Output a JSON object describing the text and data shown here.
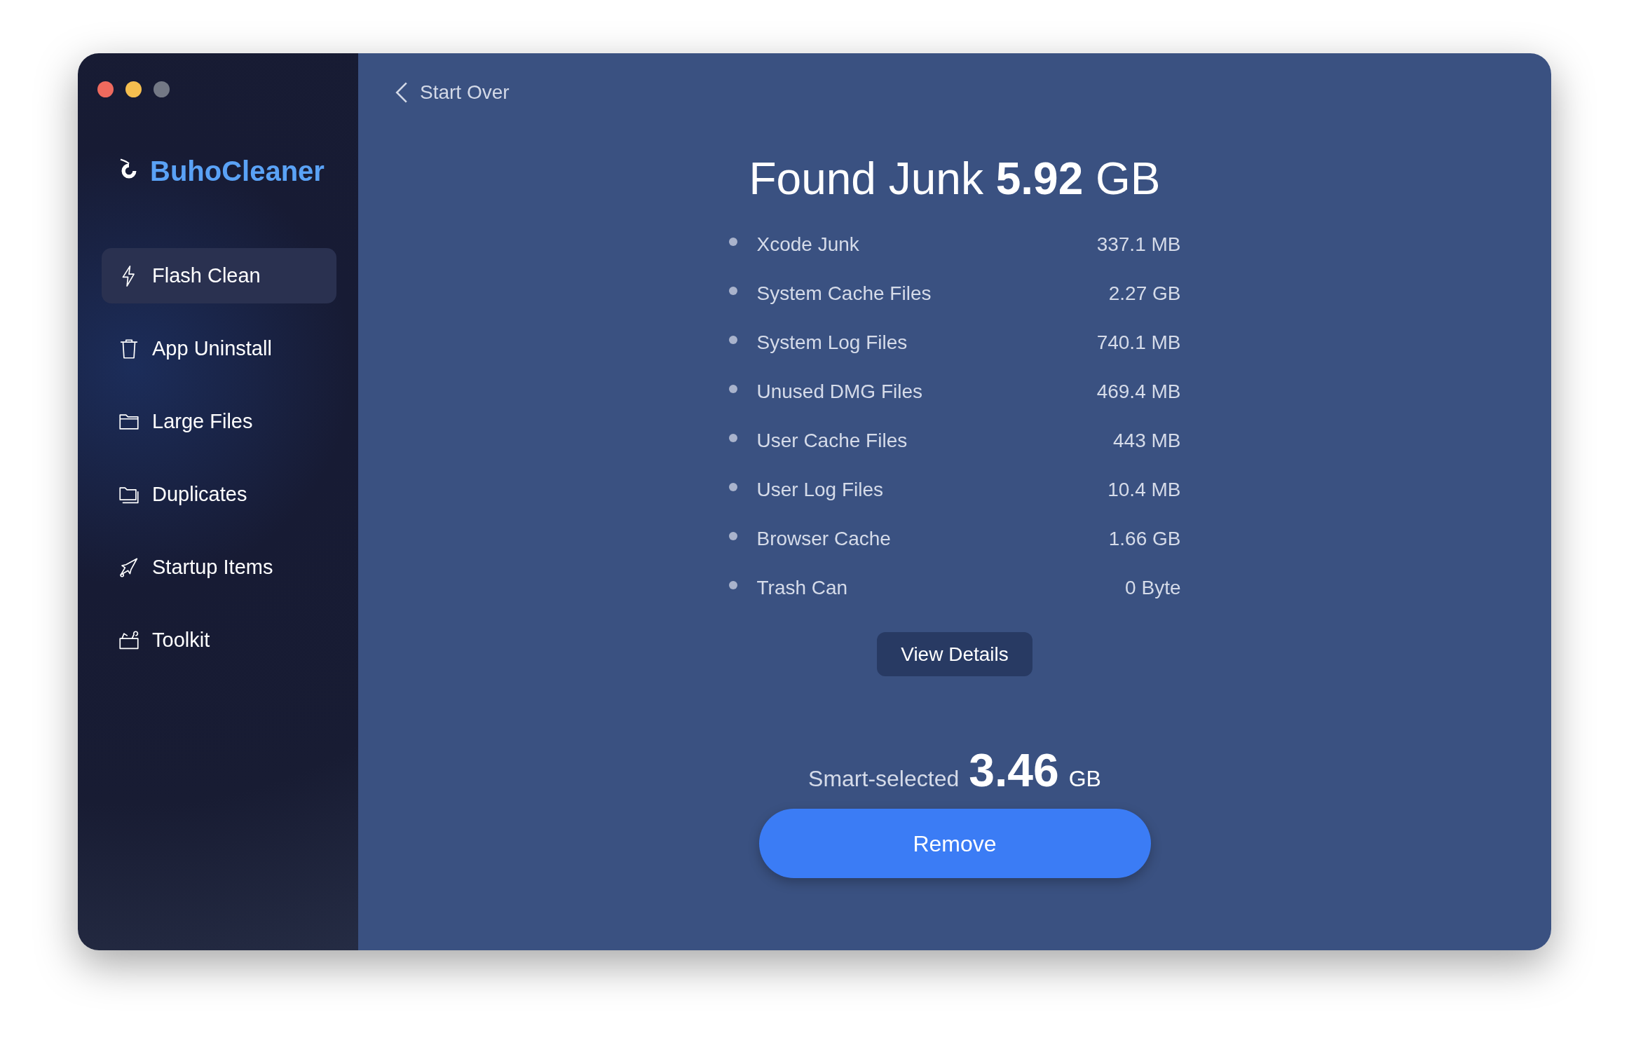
{
  "window": {
    "controls": [
      {
        "kind": "close"
      },
      {
        "kind": "minimize"
      },
      {
        "kind": "zoom"
      }
    ]
  },
  "sidebar": {
    "logo": "BuhoCleaner",
    "items": [
      {
        "label": "Flash Clean",
        "selected": true
      },
      {
        "label": "App Uninstall",
        "selected": false
      },
      {
        "label": "Large Files",
        "selected": false
      },
      {
        "label": "Duplicates",
        "selected": false
      },
      {
        "label": "Startup Items",
        "selected": false
      },
      {
        "label": "Toolkit",
        "selected": false
      }
    ]
  },
  "header": {
    "back": "Start Over"
  },
  "summary": {
    "title": "Found Junk **5.92** GB",
    "items": [
      {
        "name": "Xcode Junk",
        "size": "337.1 MB"
      },
      {
        "name": "System Cache Files",
        "size": "2.27 GB"
      },
      {
        "name": "System Log Files",
        "size": "740.1 MB"
      },
      {
        "name": "Unused DMG Files",
        "size": "469.4 MB"
      },
      {
        "name": "User Cache Files",
        "size": "443 MB"
      },
      {
        "name": "User Log Files",
        "size": "10.4 MB"
      },
      {
        "name": "Browser Cache",
        "size": "1.66 GB"
      },
      {
        "name": "Trash Can",
        "size": "0 Byte"
      }
    ],
    "details_button": "View Details",
    "selected_label": "Smart-selected",
    "selected_value": "3.46",
    "selected_unit": "GB",
    "action_button": "Remove"
  }
}
